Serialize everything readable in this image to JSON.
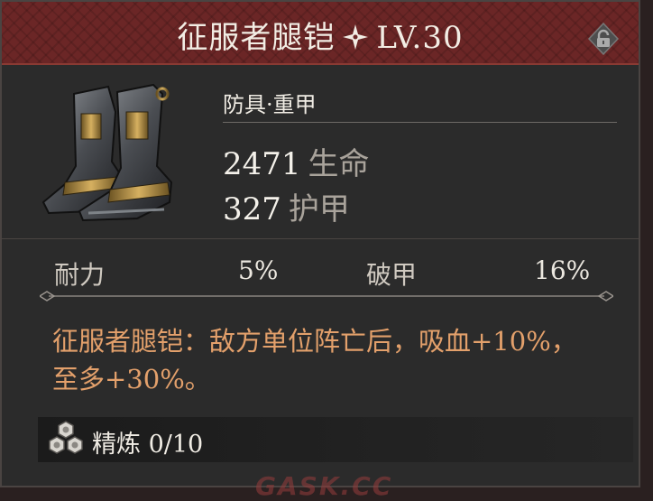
{
  "header": {
    "name": "征服者腿铠",
    "level": "LV.30",
    "star_icon": "four-point-star-icon",
    "lock_icon": "padlock-icon"
  },
  "item": {
    "icon": "armored-boots-icon",
    "type": "防具·重甲",
    "stats": [
      {
        "value": "2471",
        "label": "生命"
      },
      {
        "value": "327",
        "label": "护甲"
      }
    ]
  },
  "attributes": [
    {
      "label": "耐力",
      "value": "5%"
    },
    {
      "label": "破甲",
      "value": "16%"
    }
  ],
  "description": "征服者腿铠：敌方单位阵亡后，吸血+10%，至多+30%。",
  "refine": {
    "icon": "refine-hexagons-icon",
    "label": "精炼",
    "value": "0/10"
  },
  "watermark": "GASK.CC",
  "colors": {
    "header_bg": "#6b2626",
    "panel_bg": "#2b2b2b",
    "desc_text": "#e3a06b"
  }
}
